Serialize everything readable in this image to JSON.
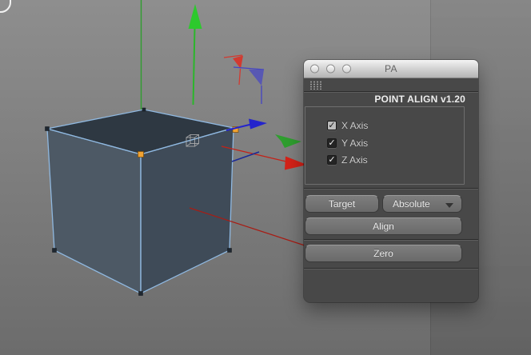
{
  "window": {
    "title": "PA",
    "traffic_lights": [
      "close",
      "minimize",
      "zoom"
    ]
  },
  "panel": {
    "header": "POINT ALIGN v1.20",
    "check_glyph": "✓",
    "checkboxes": [
      {
        "label": "X Axis",
        "checked": true
      },
      {
        "label": "Y Axis",
        "checked": true
      },
      {
        "label": "Z Axis",
        "checked": true
      }
    ],
    "buttons": {
      "target": "Target",
      "mode": "Absolute",
      "align": "Align",
      "zero": "Zero"
    }
  },
  "viewport": {
    "object": "cube",
    "selected_points": 2,
    "icons": [
      "y-axis-arrow-icon",
      "x-axis-arrow-icon",
      "z-axis-arrow-icon",
      "green-chevron-icon",
      "red-wire-gizmo-icon",
      "blue-wire-gizmo-icon",
      "wire-cube-cursor-icon",
      "lasso-corner"
    ]
  },
  "colors": {
    "accent_orange": "#f0a232",
    "axis_green": "#2dc92d",
    "axis_red": "#d42218",
    "axis_blue": "#2424cc",
    "edge_blue": "#8fb8e0",
    "panel_bg": "#484848",
    "viewport_bg": "#8e8e8e"
  }
}
